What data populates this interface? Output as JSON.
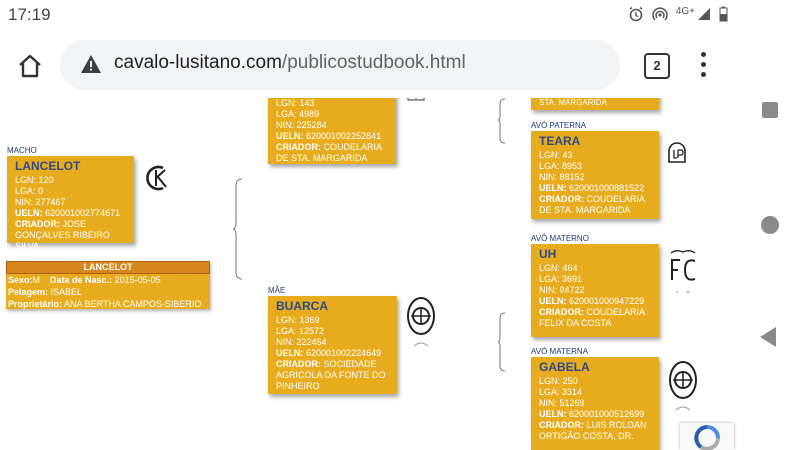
{
  "status": {
    "time": "17:19",
    "network": "4G+"
  },
  "browser": {
    "url_host": "cavalo-lusitano.com",
    "url_path": "/publicostudbook.html",
    "tab_count": "2"
  },
  "labels": {
    "macho": "MACHO",
    "mae": "MÃE",
    "avo_paterna": "AVÓ PATERNA",
    "avo_materno": "AVÔ MATERNO",
    "avo_materna": "AVÓ MATERNA"
  },
  "horses": {
    "sire": {
      "lgn": "LGN: 143",
      "lga": "LGA: 4989",
      "nin": "NIN: 225284",
      "ueln_label": "UELN:",
      "ueln": "620001002252841",
      "criador_label": "CRIADOR:",
      "criador": "COUDELARIA DE STA. MARGARIDA"
    },
    "lancelot": {
      "name": "LANCELOT",
      "lgn": "LGN: 120",
      "lga": "LGA: 0",
      "nin": "NIN: 277467",
      "ueln_label": "UELN:",
      "ueln": "620001002774671",
      "criador_label": "CRIADOR:",
      "criador": "JOSE GONÇALVES RIBEIRO SILVA"
    },
    "buarca": {
      "name": "BUARCA",
      "lgn": "LGN: 1369",
      "lga": "LGA: 12572",
      "nin": "NIN: 222464",
      "ueln_label": "UELN:",
      "ueln": "620001002224649",
      "criador_label": "CRIADOR:",
      "criador": "SOCIEDADE AGRICOLA DA FONTE DO PINHEIRO"
    },
    "teara": {
      "name": "TEARA",
      "lgn": "LGN: 43",
      "lga": "LGA: 8953",
      "nin": "NIN: 88152",
      "ueln_label": "UELN:",
      "ueln": "620001000881522",
      "criador_label": "CRIADOR:",
      "criador": "COUDELARIA DE STA. MARGARIDA"
    },
    "uh": {
      "name": "UH",
      "lgn": "LGN: 464",
      "lga": "LGA: 3691",
      "nin": "NIN: 94722",
      "ueln_label": "UELN:",
      "ueln": "620001000947229",
      "criador_label": "CRIADOR:",
      "criador": "COUDELARIA FELIX DA COSTA"
    },
    "gabela": {
      "name": "GABELA",
      "lgn": "LGN: 250",
      "lga": "LGA: 3314",
      "nin": "NIN: 51269",
      "ueln_label": "UELN:",
      "ueln": "620001000512699",
      "criador_label": "CRIADOR:",
      "criador": "LUIS ROLDAN ORTIGÃO COSTA, DR."
    }
  },
  "top_partial": "STA. MARGARIDA",
  "brands": {
    "lancelot": "CL",
    "teara": "LP",
    "uh": "FC"
  },
  "info": {
    "title": "LANCELOT",
    "sexo_label": "Sexo:",
    "sexo": "M",
    "nasc_label": "Data de Nasc.:",
    "nasc": "2015-05-05",
    "pelagem_label": "Pelagem:",
    "pelagem": "ISABEL",
    "prop_label": "Proprietário:",
    "prop": "ANA BERTHA CAMPOS-SIBERIO"
  },
  "colors": {
    "card": "#e6ac1e",
    "name": "#2f4a8a",
    "header": "#d5861c"
  }
}
